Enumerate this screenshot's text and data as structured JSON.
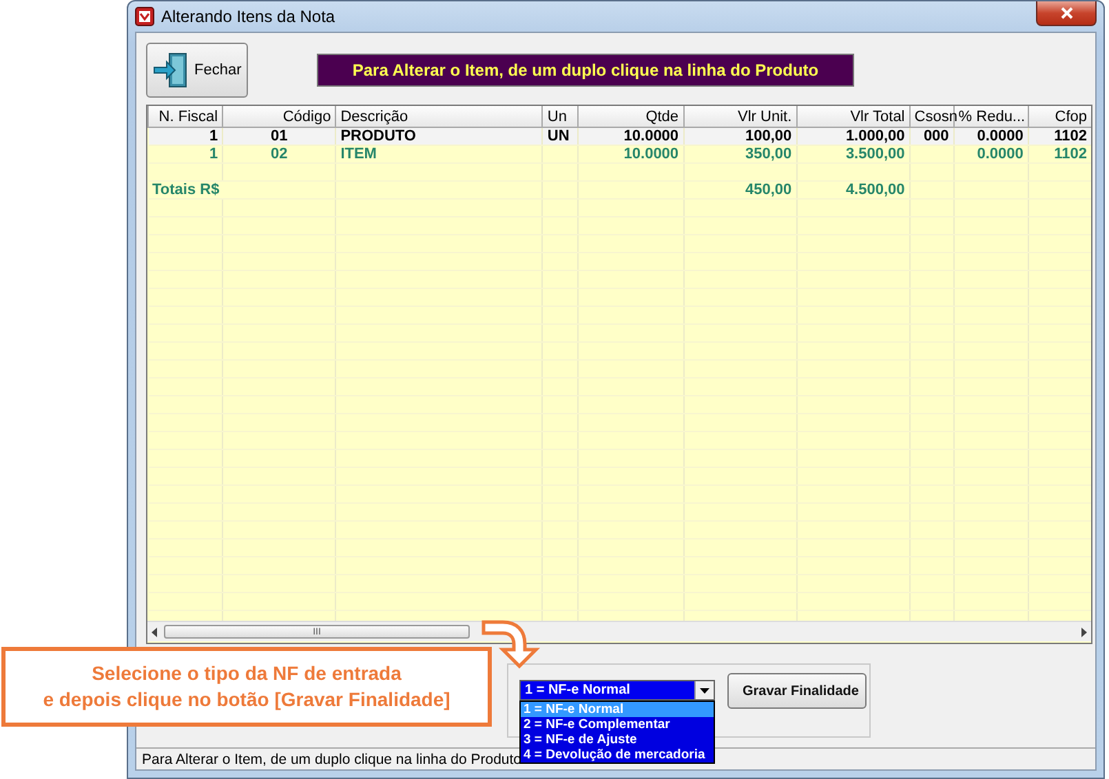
{
  "window": {
    "title": "Alterando Itens da Nota"
  },
  "toolbar": {
    "close_button": "Fechar",
    "banner": "Para Alterar o Item, de um duplo clique na linha do Produto"
  },
  "grid": {
    "columns": [
      "N. Fiscal",
      "Código",
      "Descrição",
      "Un",
      "Qtde",
      "Vlr Unit.",
      "Vlr Total",
      "Csosn",
      "% Redu...",
      "Cfop"
    ],
    "rows": [
      {
        "selected": true,
        "cells": [
          "1",
          "01",
          "PRODUTO",
          "UN",
          "10.0000",
          "100,00",
          "1.000,00",
          "000",
          "0.0000",
          "1102"
        ]
      },
      {
        "selected": false,
        "cells": [
          "1",
          "02",
          "ITEM",
          null,
          "10.0000",
          "350,00",
          "3.500,00",
          null,
          "0.0000",
          "1102"
        ]
      }
    ],
    "totals": {
      "label": "Totais R$",
      "vlr_unit": "450,00",
      "vlr_total": "4.500,00"
    },
    "scroll_thumb_grip": "III"
  },
  "finalidade": {
    "combo_value": "1 = NF-e Normal",
    "button": "Gravar Finalidade",
    "options": [
      {
        "label": "1 = NF-e Normal",
        "selected": true
      },
      {
        "label": "2 = NF-e Complementar",
        "selected": false
      },
      {
        "label": "3 = NF-e de Ajuste",
        "selected": false
      },
      {
        "label": "4 = Devolução de mercadoria",
        "selected": false
      }
    ]
  },
  "status_bar": "Para Alterar o Item, de um duplo clique na linha do Produto",
  "callout": {
    "lines": [
      "Selecione o tipo da NF de entrada",
      "e depois clique no botão [Gravar Finalidade]"
    ]
  }
}
